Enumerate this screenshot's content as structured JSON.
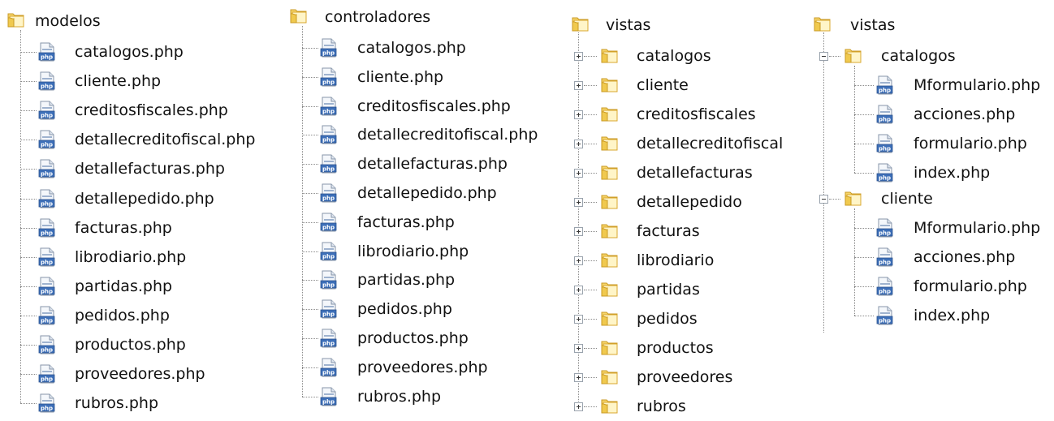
{
  "panels": [
    {
      "root": "modelos",
      "files": [
        "catalogos.php",
        "cliente.php",
        "creditosfiscales.php",
        "detallecreditofiscal.php",
        "detallefacturas.php",
        "detallepedido.php",
        "facturas.php",
        "librodiario.php",
        "partidas.php",
        "pedidos.php",
        "productos.php",
        "proveedores.php",
        "rubros.php"
      ]
    },
    {
      "root": "controladores",
      "files": [
        "catalogos.php",
        "cliente.php",
        "creditosfiscales.php",
        "detallecreditofiscal.php",
        "detallefacturas.php",
        "detallepedido.php",
        "facturas.php",
        "librodiario.php",
        "partidas.php",
        "pedidos.php",
        "productos.php",
        "proveedores.php",
        "rubros.php"
      ]
    },
    {
      "root": "vistas",
      "folders": [
        "catalogos",
        "cliente",
        "creditosfiscales",
        "detallecreditofiscal",
        "detallefacturas",
        "detallepedido",
        "facturas",
        "librodiario",
        "partidas",
        "pedidos",
        "productos",
        "proveedores",
        "rubros"
      ]
    },
    {
      "root": "vistas",
      "subfolders": [
        {
          "name": "catalogos",
          "files": [
            "Mformulario.php",
            "acciones.php",
            "formulario.php",
            "index.php"
          ]
        },
        {
          "name": "cliente",
          "files": [
            "Mformulario.php",
            "acciones.php",
            "formulario.php",
            "index.php"
          ]
        }
      ]
    }
  ],
  "icons": {
    "folder": "folder-icon",
    "file": "php-file-icon",
    "expand": "expand-plus-icon",
    "collapse": "collapse-minus-icon"
  },
  "colors": {
    "folder_light": "#fbe9a6",
    "folder_dark": "#d9a72e",
    "file_blue": "#3d6fb8",
    "tree_line": "#8a8a8a"
  }
}
